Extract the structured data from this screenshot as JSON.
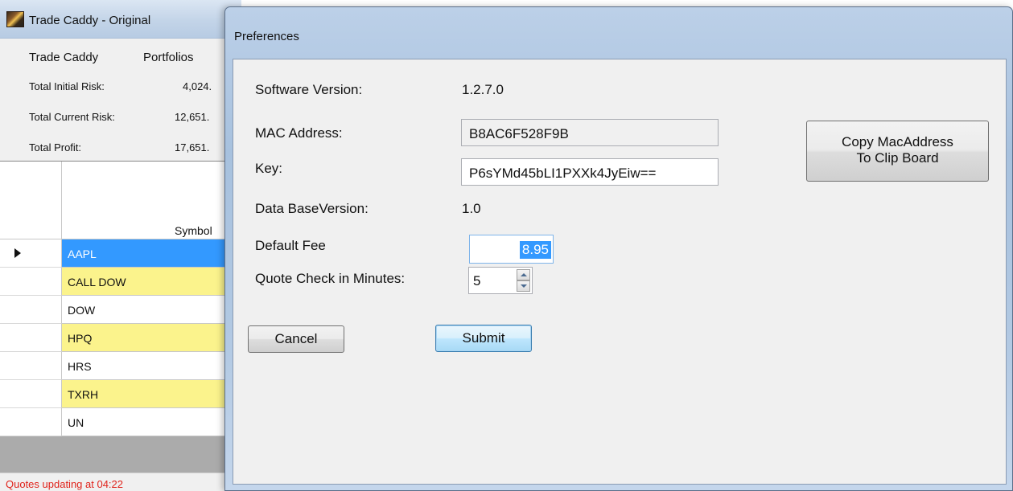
{
  "main_window": {
    "title": "Trade Caddy - Original",
    "menu": [
      "Trade Caddy",
      "Portfolios"
    ],
    "summary": [
      {
        "label": "Total Initial  Risk:",
        "value": "4,024."
      },
      {
        "label": "Total Current Risk:",
        "value": "12,651."
      },
      {
        "label": "Total Profit:",
        "value": "17,651."
      }
    ],
    "grid": {
      "column_header": "Symbol",
      "rows": [
        {
          "symbol": "AAPL",
          "style": "selected"
        },
        {
          "symbol": "CALL DOW",
          "style": "yellow"
        },
        {
          "symbol": "DOW",
          "style": "white"
        },
        {
          "symbol": "HPQ",
          "style": "yellow"
        },
        {
          "symbol": "HRS",
          "style": "white"
        },
        {
          "symbol": "TXRH",
          "style": "yellow"
        },
        {
          "symbol": "UN",
          "style": "white"
        }
      ]
    },
    "status": "Quotes updating at 04:22"
  },
  "dialog": {
    "title": "Preferences",
    "software_version_label": "Software Version:",
    "software_version_value": "1.2.7.0",
    "mac_label": "MAC Address:",
    "mac_value": "B8AC6F528F9B",
    "key_label": "Key:",
    "key_value": "P6sYMd45bLI1PXXk4JyEiw==",
    "db_version_label": "Data BaseVersion:",
    "db_version_value": "1.0",
    "fee_label": "Default Fee",
    "fee_value": "8.95",
    "quote_label": "Quote Check in Minutes:",
    "quote_value": "5",
    "copy_button_line1": "Copy MacAddress",
    "copy_button_line2": "To Clip Board",
    "cancel_label": "Cancel",
    "submit_label": "Submit"
  },
  "colors": {
    "selected_row": "#3399ff",
    "highlight_row": "#fbf38c",
    "status_text": "#e0231b"
  }
}
